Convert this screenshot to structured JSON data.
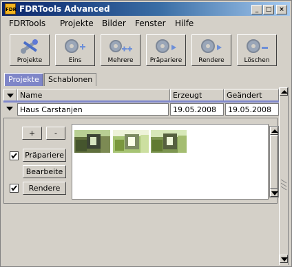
{
  "window": {
    "title": "FDRTools Advanced",
    "app_icon_text": "FDR",
    "controls": [
      "_",
      "□",
      "×"
    ]
  },
  "menu": [
    "FDRTools",
    "Projekte",
    "Bilder",
    "Fenster",
    "Hilfe"
  ],
  "toolbar": {
    "buttons": [
      {
        "label": "Projekte",
        "icon": "tools-icon"
      },
      {
        "label": "Eins",
        "icon": "gear-plus-icon"
      },
      {
        "label": "Mehrere",
        "icon": "gear-plusplus-icon"
      },
      {
        "label": "Präpariere",
        "icon": "gear-play-icon"
      },
      {
        "label": "Rendere",
        "icon": "gear-play-icon"
      },
      {
        "label": "Löschen",
        "icon": "gear-minus-icon"
      }
    ]
  },
  "tabs": [
    {
      "label": "Projekte",
      "active": true
    },
    {
      "label": "Schablonen",
      "active": false
    }
  ],
  "table": {
    "columns": [
      "Name",
      "Erzeugt",
      "Geändert"
    ],
    "rows": [
      {
        "name": "Haus Carstanjen",
        "created": "19.05.2008",
        "modified": "19.05.2008"
      }
    ]
  },
  "panel": {
    "add_label": "+",
    "remove_label": "-",
    "prepare_label": "Präpariere",
    "prepare_checked": true,
    "edit_label": "Bearbeite",
    "render_label": "Rendere",
    "render_checked": true,
    "thumbnail_count": 3
  },
  "colors": {
    "titlebar": "#0a246a",
    "active_tab": "#7f86c8",
    "window_bg": "#d4d0c8",
    "tool_icon": "#9aa6b8",
    "tool_icon_accent": "#6d8fd8"
  }
}
